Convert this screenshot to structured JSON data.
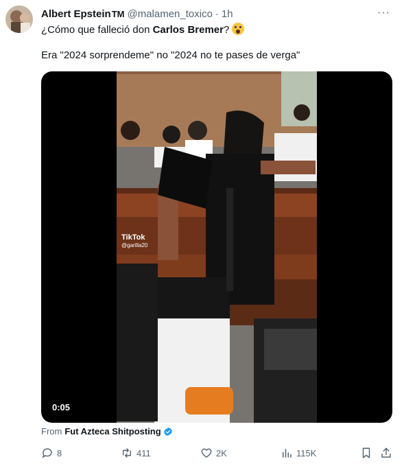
{
  "tweet": {
    "author_name": "Albert Epstein",
    "author_suffix": "TM",
    "handle": "@malamen_toxico",
    "separator": "·",
    "time": "1h",
    "more_label": "···",
    "line1_prefix": "¿Cómo que falleció don ",
    "line1_bold": "Carlos Bremer",
    "line1_suffix": "?",
    "line2": "Era \"2024 sorprendeme\"  no \"2024 no te pases de verga\""
  },
  "media": {
    "duration": "0:05",
    "watermark_title": "TikTok",
    "watermark_handle": "@garilla20"
  },
  "source": {
    "prefix": "From",
    "name": "Fut Azteca Shitposting"
  },
  "actions": {
    "replies": "8",
    "retweets": "411",
    "likes": "2K",
    "views": "115K"
  },
  "colors": {
    "text": "#0f1419",
    "muted": "#536471",
    "verified": "#1d9bf0"
  }
}
